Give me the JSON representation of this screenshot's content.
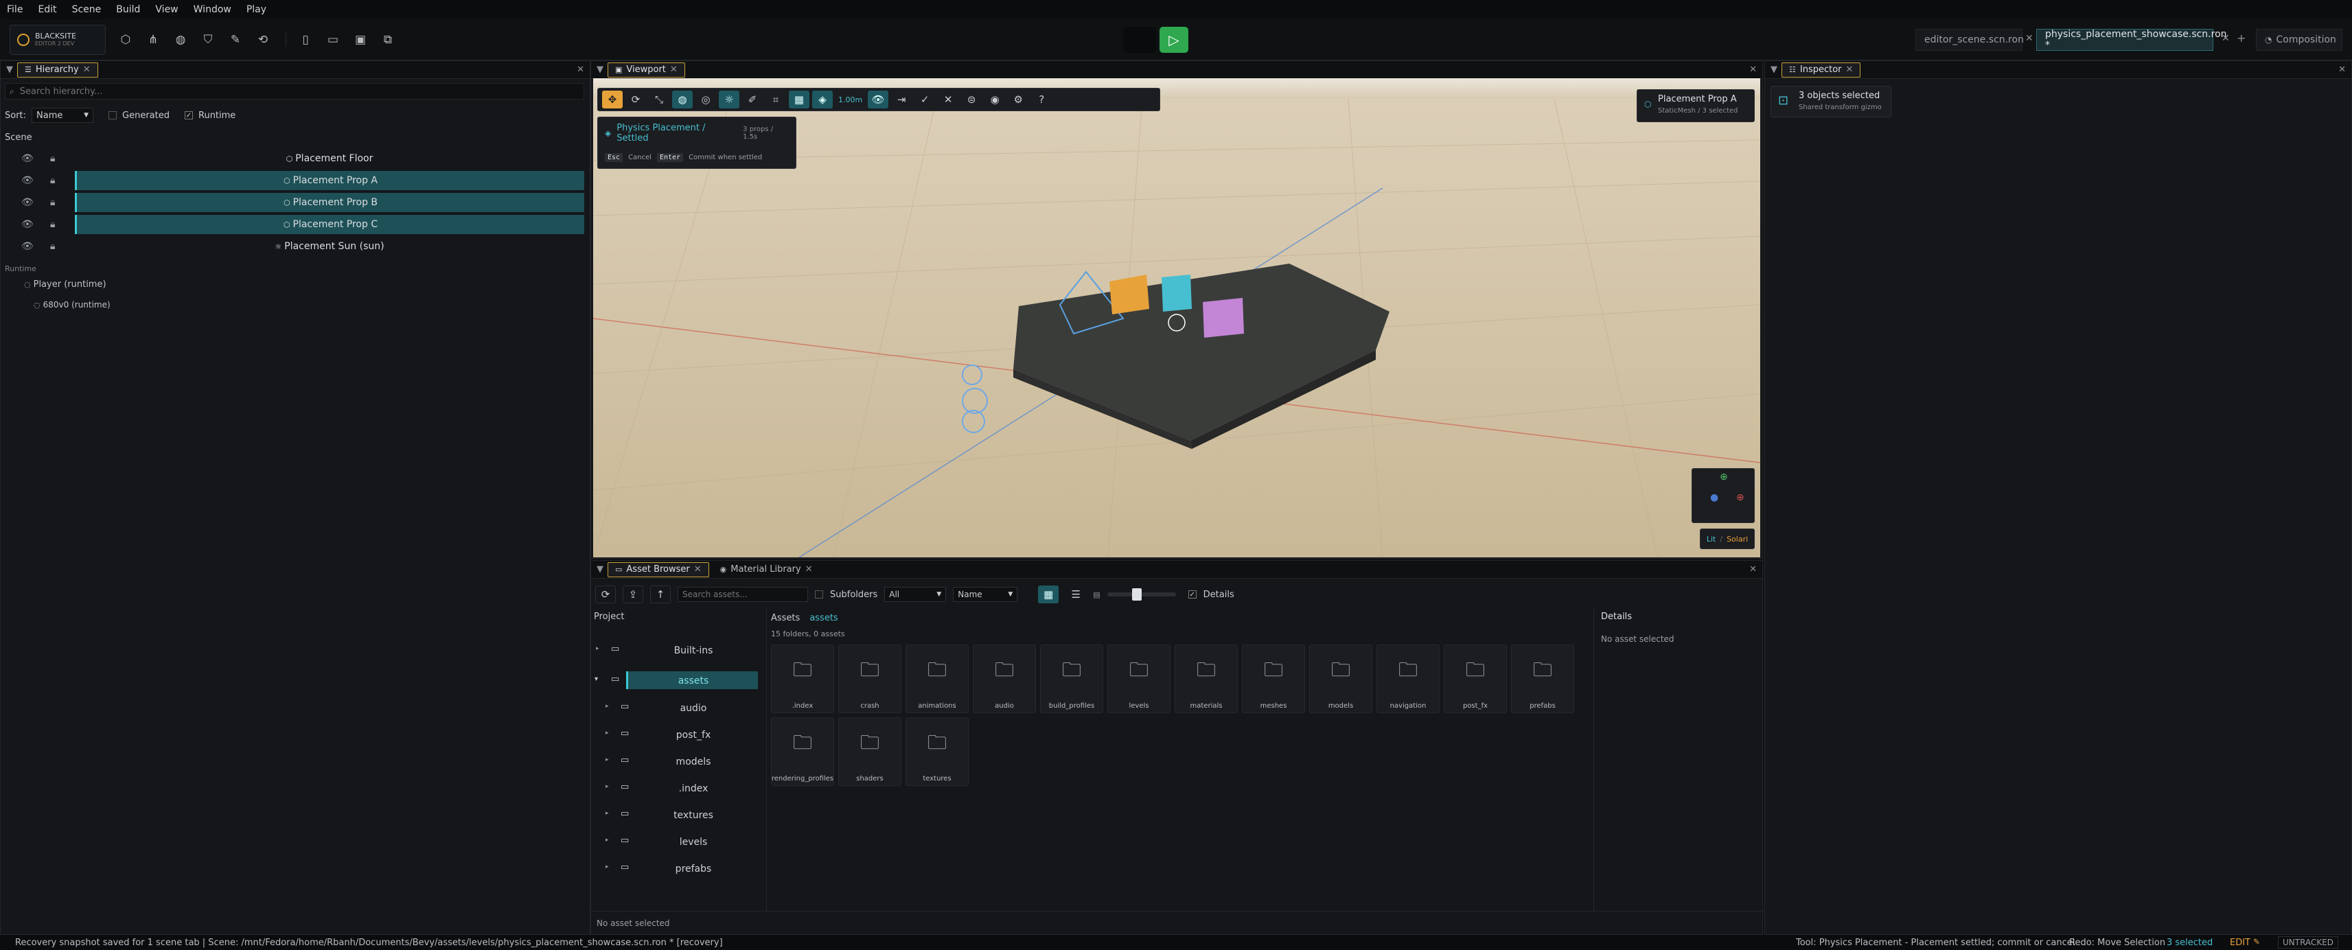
{
  "menu": [
    "File",
    "Edit",
    "Scene",
    "Build",
    "View",
    "Window",
    "Play"
  ],
  "brand": {
    "name": "BLACKSITE",
    "sub": "EDITOR 2 DEV"
  },
  "toolbar_icons": [
    "cube-icon",
    "hierarchy-icon",
    "globe-icon",
    "shield-icon",
    "pencil-icon",
    "link-icon",
    "new-file-icon",
    "open-folder-icon",
    "save-icon",
    "copy-icon"
  ],
  "document_tabs": [
    {
      "label": "editor_scene.scn.ron",
      "active": false
    },
    {
      "label": "physics_placement_showcase.scn.ron *",
      "active": true
    }
  ],
  "composition_label": "Composition",
  "hierarchy": {
    "tab": "Hierarchy",
    "search_placeholder": "Search hierarchy...",
    "sort_label": "Sort:",
    "sort_value": "Name",
    "generated_label": "Generated",
    "runtime_label": "Runtime",
    "scene_label": "Scene",
    "items": [
      {
        "label": "Placement Floor",
        "selected": false
      },
      {
        "label": "Placement Prop A",
        "selected": true
      },
      {
        "label": "Placement Prop B",
        "selected": true
      },
      {
        "label": "Placement Prop C",
        "selected": true
      },
      {
        "label": "Placement Sun  (sun)",
        "selected": false
      }
    ],
    "runtime_section": "Runtime",
    "runtime_items": [
      "Player  (runtime)",
      "680v0  (runtime)"
    ]
  },
  "viewport": {
    "tab": "Viewport",
    "scale_label": "1.00m",
    "status_title": "Physics Placement / Settled",
    "status_detail": "3 props / 1.5s",
    "key_esc": "Esc",
    "esc_action": "Cancel",
    "key_enter": "Enter",
    "enter_action": "Commit when settled",
    "selected_title": "Placement Prop A",
    "selected_sub": "StaticMesh  /  3 selected",
    "lit_label": "Lit",
    "solari_label": "Solari"
  },
  "inspector": {
    "tab": "Inspector",
    "title": "3 objects selected",
    "subtitle": "Shared transform gizmo"
  },
  "asset_browser": {
    "tabs": [
      "Asset Browser",
      "Material Library"
    ],
    "search_placeholder": "Search assets...",
    "subfolders_label": "Subfolders",
    "filter_value": "All",
    "sort_value": "Name",
    "details_label": "Details",
    "project_label": "Project",
    "tree": [
      {
        "label": "Built-ins",
        "selected": false
      },
      {
        "label": "assets",
        "selected": true
      },
      {
        "label": "audio",
        "selected": false
      },
      {
        "label": "post_fx",
        "selected": false
      },
      {
        "label": "models",
        "selected": false
      },
      {
        "label": ".index",
        "selected": false
      },
      {
        "label": "textures",
        "selected": false
      },
      {
        "label": "levels",
        "selected": false
      },
      {
        "label": "prefabs",
        "selected": false
      }
    ],
    "breadcrumb_root": "Assets",
    "breadcrumb_current": "assets",
    "count_text": "15 folders, 0 assets",
    "folders": [
      ".index",
      "crash",
      "animations",
      "audio",
      "build_profiles",
      "levels",
      "materials",
      "meshes",
      "models",
      "navigation",
      "post_fx",
      "prefabs",
      "rendering_profiles",
      "shaders",
      "textures"
    ],
    "details_title": "Details",
    "details_empty": "No asset selected",
    "footer": "No asset selected"
  },
  "status": {
    "left": "Recovery snapshot saved for 1 scene tab  |  Scene: /mnt/Fedora/home/Rbanh/Documents/Bevy/assets/levels/physics_placement_showcase.scn.ron * [recovery]",
    "tool": "Tool: Physics Placement - Placement settled; commit or cancel",
    "redo": "Redo: Move Selection",
    "selected": "3 selected",
    "mode": "EDIT",
    "untracked": "UNTRACKED"
  },
  "colors": {
    "accent": "#3cc9d6",
    "selection": "#1d5157",
    "tab_border": "#c9a13a",
    "play": "#2fa84f",
    "orange_tool": "#e8a23a"
  }
}
